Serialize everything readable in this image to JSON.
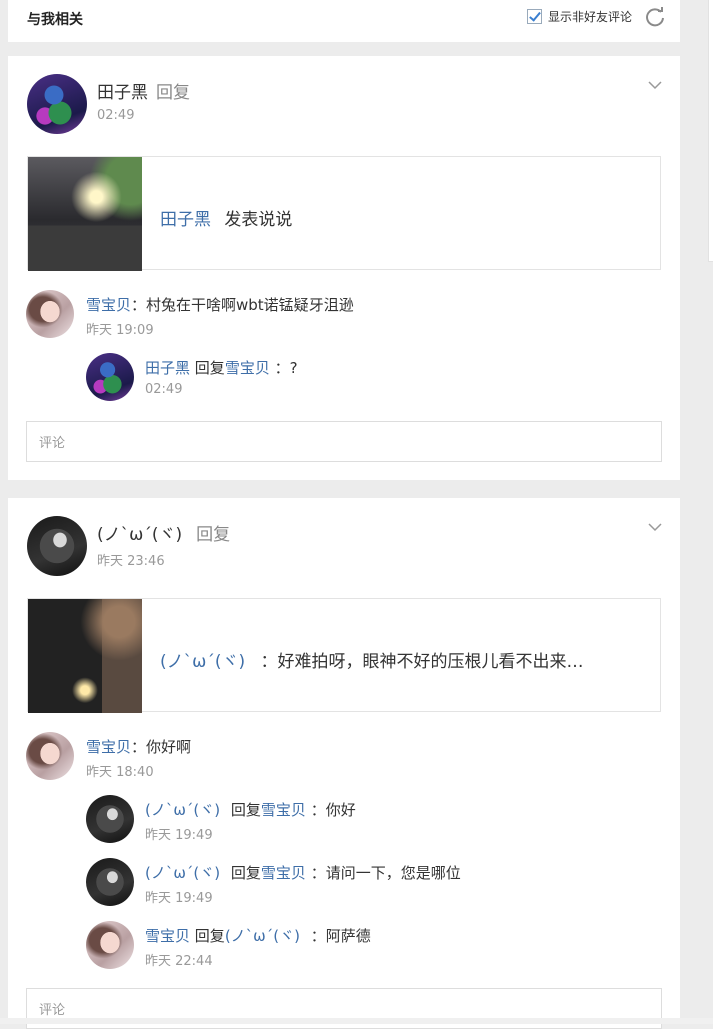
{
  "header": {
    "title": "与我相关",
    "filter_label": "显示非好友评论",
    "filter_checked": true
  },
  "posts": [
    {
      "author": "田子黑",
      "action": "回复",
      "time": "02:49",
      "share": {
        "author": "田子黑",
        "text": "发表说说"
      },
      "comments": [
        {
          "name": "雪宝贝",
          "text": "：村兔在干啥啊wbt诺锰疑牙沮逊",
          "time": "昨天 19:09"
        }
      ],
      "replies": [
        {
          "name": "田子黑",
          "reply_word": "回复",
          "target": "雪宝贝",
          "text": "：?",
          "time": "02:49"
        }
      ],
      "comment_placeholder": "评论"
    },
    {
      "author": "(ノ`ω´(ヾ)",
      "action": "回复",
      "time": "昨天 23:46",
      "share": {
        "author": "(ノ`ω´(ヾ)",
        "text": "：好难拍呀，眼神不好的压根儿看不出来…"
      },
      "comments": [
        {
          "name": "雪宝贝",
          "text": "：你好啊",
          "time": "昨天 18:40"
        }
      ],
      "replies": [
        {
          "name": "(ノ`ω´(ヾ)",
          "reply_word": "回复",
          "target": "雪宝贝",
          "text": "：你好",
          "time": "昨天 19:49"
        },
        {
          "name": "(ノ`ω´(ヾ)",
          "reply_word": "回复",
          "target": "雪宝贝",
          "text": "：请问一下，您是哪位",
          "time": "昨天 19:49"
        },
        {
          "name": "雪宝贝",
          "reply_word": "回复",
          "target": "(ノ`ω´(ヾ)",
          "text": "：阿萨德",
          "time": "昨天 22:44"
        }
      ],
      "comment_placeholder": "评论"
    }
  ],
  "icons": {
    "refresh": "refresh-icon",
    "chevron": "chevron-down-icon",
    "checkbox": "checkbox-checked-icon"
  },
  "colors": {
    "link": "#3e6ea8",
    "muted": "#999999",
    "background": "#ececec"
  }
}
